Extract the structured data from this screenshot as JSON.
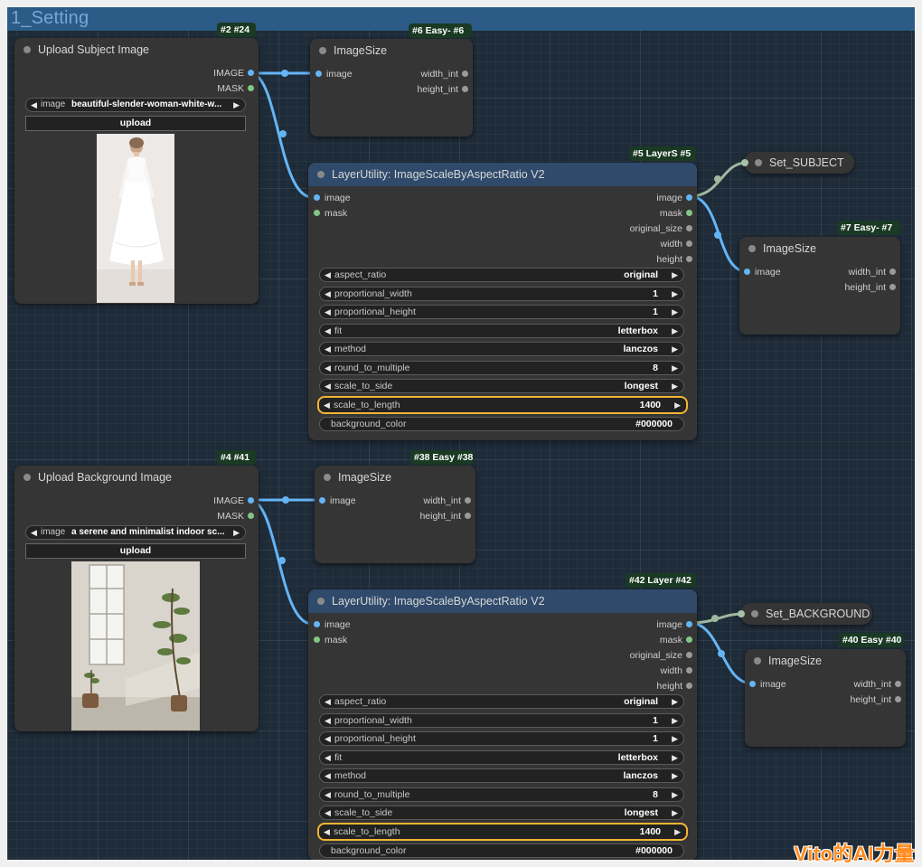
{
  "group": {
    "title": "1_Setting"
  },
  "colors": {
    "image_link": "#64b5f6",
    "mask_pin": "#81c784",
    "set_link": "#9fb89f",
    "highlight": "#f2b533",
    "watermark": "#ff8a1c"
  },
  "nodes": {
    "load_subject": {
      "title": "Upload Subject Image",
      "badge": "#2 #24",
      "outputs": [
        "IMAGE",
        "MASK"
      ],
      "image_label": "image",
      "image_value": "beautiful-slender-woman-white-w...",
      "upload_label": "upload"
    },
    "size_6": {
      "title": "ImageSize",
      "badge": "#6 Easy- #6",
      "input": "image",
      "outputs": [
        "width_int",
        "height_int"
      ]
    },
    "scale_5": {
      "title": "LayerUtility: ImageScaleByAspectRatio V2",
      "badge": "#5 LayerS #5",
      "inputs": [
        "image",
        "mask"
      ],
      "outputs": [
        "image",
        "mask",
        "original_size",
        "width",
        "height"
      ],
      "widgets": [
        {
          "label": "aspect_ratio",
          "value": "original"
        },
        {
          "label": "proportional_width",
          "value": "1"
        },
        {
          "label": "proportional_height",
          "value": "1"
        },
        {
          "label": "fit",
          "value": "letterbox"
        },
        {
          "label": "method",
          "value": "lanczos"
        },
        {
          "label": "round_to_multiple",
          "value": "8"
        },
        {
          "label": "scale_to_side",
          "value": "longest"
        },
        {
          "label": "scale_to_length",
          "value": "1400"
        },
        {
          "label": "background_color",
          "value": "#000000"
        }
      ]
    },
    "set_subject": {
      "title": "Set_SUBJECT"
    },
    "size_7": {
      "title": "ImageSize",
      "badge": "#7 Easy- #7",
      "input": "image",
      "outputs": [
        "width_int",
        "height_int"
      ]
    },
    "load_background": {
      "title": "Upload Background Image",
      "badge": "#4 #41",
      "outputs": [
        "IMAGE",
        "MASK"
      ],
      "image_label": "image",
      "image_value": "a serene and minimalist indoor sc...",
      "upload_label": "upload"
    },
    "size_38": {
      "title": "ImageSize",
      "badge": "#38 Easy #38",
      "input": "image",
      "outputs": [
        "width_int",
        "height_int"
      ]
    },
    "scale_42": {
      "title": "LayerUtility: ImageScaleByAspectRatio V2",
      "badge": "#42 Layer #42",
      "inputs": [
        "image",
        "mask"
      ],
      "outputs": [
        "image",
        "mask",
        "original_size",
        "width",
        "height"
      ],
      "widgets": [
        {
          "label": "aspect_ratio",
          "value": "original"
        },
        {
          "label": "proportional_width",
          "value": "1"
        },
        {
          "label": "proportional_height",
          "value": "1"
        },
        {
          "label": "fit",
          "value": "letterbox"
        },
        {
          "label": "method",
          "value": "lanczos"
        },
        {
          "label": "round_to_multiple",
          "value": "8"
        },
        {
          "label": "scale_to_side",
          "value": "longest"
        },
        {
          "label": "scale_to_length",
          "value": "1400"
        },
        {
          "label": "background_color",
          "value": "#000000"
        }
      ]
    },
    "set_background": {
      "title": "Set_BACKGROUND"
    },
    "size_40": {
      "title": "ImageSize",
      "badge": "#40 Easy #40",
      "input": "image",
      "outputs": [
        "width_int",
        "height_int"
      ]
    }
  },
  "watermark": "Vito的AI力量"
}
